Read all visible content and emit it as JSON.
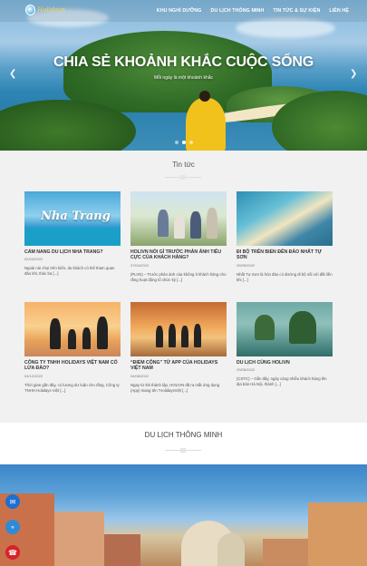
{
  "brand": {
    "logo_text": "Holidays",
    "logo_sub": "VIỆT NAM"
  },
  "nav": {
    "items": [
      "KHU NGHỈ DƯỠNG",
      "DU LỊCH THÔNG MINH",
      "TIN TỨC & SỰ KIỆN",
      "LIÊN HỆ"
    ]
  },
  "hero": {
    "title": "CHIA SẺ KHOẢNH KHẮC CUỘC SỐNG",
    "subtitle": "Mỗi ngày là một khoảnh khắc",
    "prev_icon": "chevron-left-icon",
    "next_icon": "chevron-right-icon",
    "slide_count": 3,
    "active_slide": 1
  },
  "news": {
    "title": "Tin tức",
    "cards": [
      {
        "title": "CẨM NANG DU LỊCH NHA TRANG?",
        "date": "02/04/2022",
        "excerpt": "Ngoài núi chọi trên biển, du khách có thể tham quan đảo khỉ, thác ba [...]",
        "thumb_text": "Nha Trang"
      },
      {
        "title": "HOLIVN NÓI GÌ TRƯỚC PHẢN ÁNH TIÊU CỰC CỦA KHÁCH HÀNG?",
        "date": "07/04/2022",
        "excerpt": "(PLVN) – Trước phản ánh của không ít khách hàng cho rằng hoạt động tổ chức kỳ [...]",
        "thumb_text": ""
      },
      {
        "title": "ĐI BỘ TRÊN BIỂN ĐẾN ĐẢO NHẤT TỰ SƠN",
        "date": "29/05/2022",
        "excerpt": "Nhất Tự Sơn là hòn đảo có đường đi bộ nối với đất liền khi [...]",
        "thumb_text": ""
      },
      {
        "title": "CÔNG TY TNHH HOLIDAYS VIỆT NAM CÓ LỪA ĐẢO?",
        "date": "04/12/2022",
        "excerpt": "Thời gian gần đây, có lượng dư luận cho rằng, Công ty TNHH Holidays Việt [...]",
        "thumb_text": ""
      },
      {
        "title": "“ĐIỂM CỘNG” TỪ APP CỦA HOLIDAYS VIỆT NAM",
        "date": "04/08/2022",
        "excerpt": "Ngay từ khi thành lập, HOLIVN đã ra mắt ứng dụng (App) mang tên “HolidaysViệt [...]",
        "thumb_text": ""
      },
      {
        "title": "DU LỊCH CÙNG HOLIVN",
        "date": "29/08/2022",
        "excerpt": "(CSTC) – Gần đây, ngày càng nhiều khách hàng lên dịa bàn Hà Nội, thành [...]",
        "thumb_text": ""
      }
    ]
  },
  "smart": {
    "title": "DU LỊCH THÔNG MINH"
  },
  "floating": [
    {
      "icon": "chat-icon",
      "color": "#1e6fd0"
    },
    {
      "icon": "messenger-icon",
      "color": "#2f8ad8"
    },
    {
      "icon": "phone-icon",
      "color": "#d6232a"
    }
  ]
}
